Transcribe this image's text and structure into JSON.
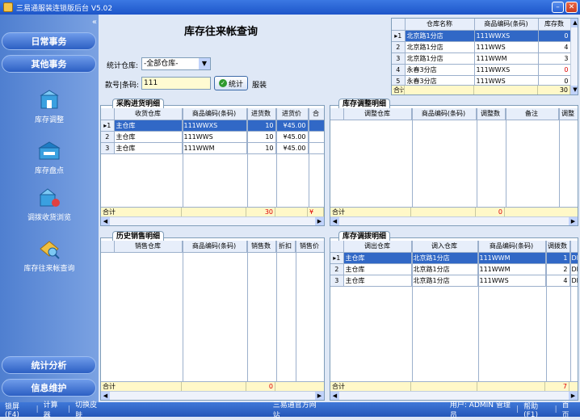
{
  "window": {
    "title": "三易通服装连锁版后台 V5.02"
  },
  "sidebar": {
    "collapse": "«",
    "nav_daily": "日常事务",
    "nav_other": "其他事务",
    "tools": [
      {
        "label": "库存调整",
        "icon": "inventory-adjust-icon"
      },
      {
        "label": "库存盘点",
        "icon": "inventory-count-icon"
      },
      {
        "label": "调拨收货浏览",
        "icon": "transfer-receipt-icon"
      },
      {
        "label": "库存往来帐查询",
        "icon": "ledger-query-icon"
      }
    ],
    "nav_stats": "统计分析",
    "nav_info": "信息维护"
  },
  "form": {
    "title": "库存往来帐查询",
    "warehouse_label": "统计仓库:",
    "warehouse_value": "-全部仓库-",
    "code_label": "款号|条码:",
    "code_value": "111",
    "stat_button": "统计",
    "category_text": "服装"
  },
  "stock_grid": {
    "headers": [
      "仓库名称",
      "商品编码(条码)",
      "库存数"
    ],
    "rows": [
      {
        "n": "1",
        "wh": "北京路1分店",
        "code": "111WWXS",
        "qty": "0",
        "red": false,
        "sel": true
      },
      {
        "n": "2",
        "wh": "北京路1分店",
        "code": "111WWS",
        "qty": "4",
        "red": false,
        "sel": false
      },
      {
        "n": "3",
        "wh": "北京路1分店",
        "code": "111WWM",
        "qty": "3",
        "red": false,
        "sel": false
      },
      {
        "n": "4",
        "wh": "永春3分店",
        "code": "111WWXS",
        "qty": "0",
        "red": true,
        "sel": false
      },
      {
        "n": "5",
        "wh": "永春3分店",
        "code": "111WWS",
        "qty": "0",
        "red": false,
        "sel": false
      }
    ],
    "total_label": "合计",
    "total_qty": "30"
  },
  "purchase": {
    "tab": "采购进货明细",
    "headers": [
      "收货仓库",
      "商品编码(条码)",
      "进货数",
      "进货价",
      "合"
    ],
    "rows": [
      {
        "n": "1",
        "wh": "主仓库",
        "code": "111WWXS",
        "qty": "10",
        "price": "¥45.00",
        "sel": true
      },
      {
        "n": "2",
        "wh": "主仓库",
        "code": "111WWS",
        "qty": "10",
        "price": "¥45.00",
        "sel": false
      },
      {
        "n": "3",
        "wh": "主仓库",
        "code": "111WWM",
        "qty": "10",
        "price": "¥45.00",
        "sel": false
      }
    ],
    "total_label": "合计",
    "total_qty": "30",
    "total_extra": "¥"
  },
  "adjust": {
    "tab": "库存调整明细",
    "headers": [
      "调整仓库",
      "商品编码(条码)",
      "调整数",
      "备注",
      "调整"
    ],
    "total_label": "合计",
    "total_qty": "0"
  },
  "sales": {
    "tab": "历史销售明细",
    "headers": [
      "销售仓库",
      "商品编码(条码)",
      "销售数",
      "折扣",
      "销售价"
    ],
    "total_label": "合计",
    "total_qty": "0"
  },
  "transfer": {
    "tab": "库存调拨明细",
    "headers": [
      "调出仓库",
      "调入仓库",
      "商品编码(条码)",
      "调拨数"
    ],
    "rows": [
      {
        "n": "1",
        "from": "主仓库",
        "to": "北京路1分店",
        "code": "111WWM",
        "qty": "1",
        "extra": "DE",
        "sel": true
      },
      {
        "n": "2",
        "from": "主仓库",
        "to": "北京路1分店",
        "code": "111WWM",
        "qty": "2",
        "extra": "DE",
        "sel": false
      },
      {
        "n": "3",
        "from": "主仓库",
        "to": "北京路1分店",
        "code": "111WWS",
        "qty": "4",
        "extra": "DE",
        "sel": false
      }
    ],
    "total_label": "合计",
    "total_qty": "7"
  },
  "statusbar": {
    "lock": "锁屏(F4)",
    "calc": "计算器",
    "skin": "切换皮肤",
    "website": "三易通官方网站",
    "user": "用户: ADMIN 管理员",
    "help": "帮助(F1)",
    "home": "首页"
  }
}
